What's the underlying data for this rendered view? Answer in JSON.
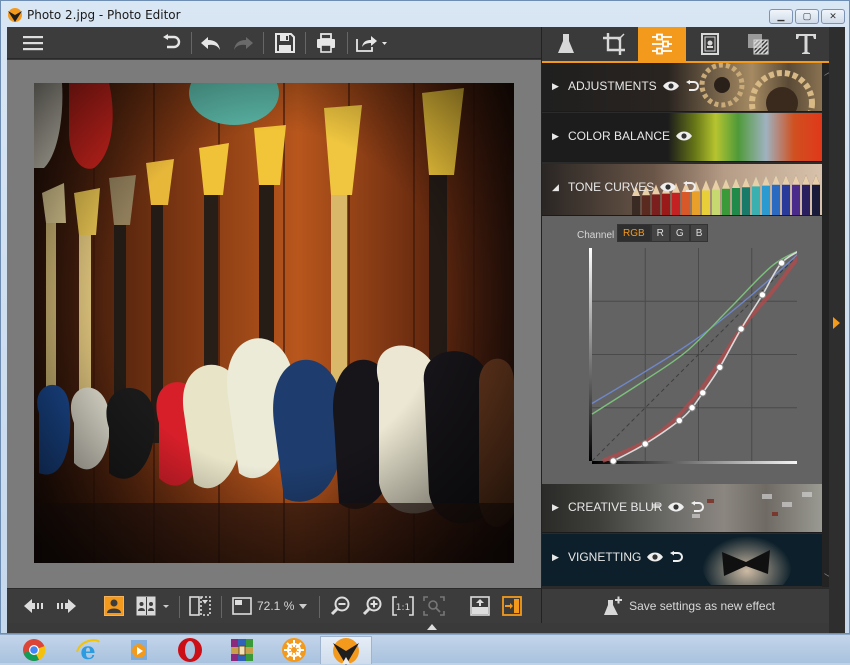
{
  "window": {
    "title": "Photo 2.jpg - Photo Editor",
    "controls": [
      "minimize",
      "maximize",
      "close"
    ]
  },
  "toolbar": {
    "items": [
      {
        "name": "menu",
        "icon": "hamburger-icon"
      },
      {
        "name": "revert",
        "icon": "revert-icon"
      },
      {
        "name": "undo",
        "icon": "undo-icon"
      },
      {
        "name": "redo",
        "icon": "redo-icon",
        "disabled": true
      },
      {
        "name": "save",
        "icon": "save-icon"
      },
      {
        "name": "print",
        "icon": "print-icon"
      },
      {
        "name": "share",
        "icon": "share-icon"
      }
    ]
  },
  "panel_tabs": [
    {
      "name": "effects",
      "icon": "flask-icon"
    },
    {
      "name": "crop",
      "icon": "crop-icon"
    },
    {
      "name": "adjust",
      "icon": "sliders-icon",
      "active": true
    },
    {
      "name": "frames",
      "icon": "frame-icon"
    },
    {
      "name": "textures",
      "icon": "texture-icon"
    },
    {
      "name": "text",
      "icon": "text-icon"
    }
  ],
  "sections": [
    {
      "label": "ADJUSTMENTS",
      "expanded": false,
      "show_eye": true,
      "show_reset": true
    },
    {
      "label": "COLOR BALANCE",
      "expanded": false,
      "show_eye": true,
      "show_reset": false
    },
    {
      "label": "TONE CURVES",
      "expanded": true,
      "show_eye": true,
      "show_reset": true
    },
    {
      "label": "CREATIVE BLUR",
      "expanded": false,
      "show_eye": true,
      "show_reset": true
    },
    {
      "label": "VIGNETTING",
      "expanded": false,
      "show_eye": true,
      "show_reset": true
    }
  ],
  "tone_curves": {
    "channel_label": "Channel",
    "channels": [
      "RGB",
      "R",
      "G",
      "B"
    ],
    "active_channel": "RGB",
    "curves": {
      "rgb": [
        [
          0.1,
          0.0
        ],
        [
          0.25,
          0.08
        ],
        [
          0.41,
          0.19
        ],
        [
          0.47,
          0.25
        ],
        [
          0.52,
          0.32
        ],
        [
          0.6,
          0.44
        ],
        [
          0.7,
          0.62
        ],
        [
          0.8,
          0.78
        ],
        [
          0.89,
          0.93
        ],
        [
          1.0,
          1.0
        ]
      ],
      "red": [
        [
          0.05,
          0.0
        ],
        [
          0.3,
          0.12
        ],
        [
          0.5,
          0.32
        ],
        [
          0.7,
          0.62
        ],
        [
          0.85,
          0.8
        ],
        [
          1.0,
          1.0
        ]
      ],
      "green": [
        [
          0.0,
          0.22
        ],
        [
          0.25,
          0.38
        ],
        [
          0.45,
          0.52
        ],
        [
          0.65,
          0.72
        ],
        [
          0.85,
          0.92
        ],
        [
          1.0,
          1.0
        ]
      ],
      "blue": [
        [
          0.0,
          0.27
        ],
        [
          0.25,
          0.42
        ],
        [
          0.5,
          0.58
        ],
        [
          0.75,
          0.78
        ],
        [
          1.0,
          1.0
        ]
      ]
    },
    "colors": {
      "rgb": "#d9d9d9",
      "red": "#b44a4a",
      "green": "#7cc07c",
      "blue": "#6f86c8"
    }
  },
  "bottom_toolbar": {
    "zoom_value": "72.1 %",
    "items": [
      "prev-photo",
      "next-photo",
      "single-view",
      "compare-view",
      "before-after",
      "zoom-select",
      "zoom-out",
      "zoom-in",
      "actual-size",
      "fit-to-screen",
      "export",
      "toggle-panel"
    ]
  },
  "save_effect_label": "Save settings as new effect",
  "taskbar": {
    "apps": [
      "chrome",
      "internet-explorer",
      "media-player",
      "opera",
      "winrar",
      "app-orange",
      "photo-editor"
    ],
    "active": "photo-editor"
  },
  "colors": {
    "accent": "#f39a1c",
    "panel_bg": "#2b2b2b",
    "canvas_bg": "#7b7b7b"
  }
}
